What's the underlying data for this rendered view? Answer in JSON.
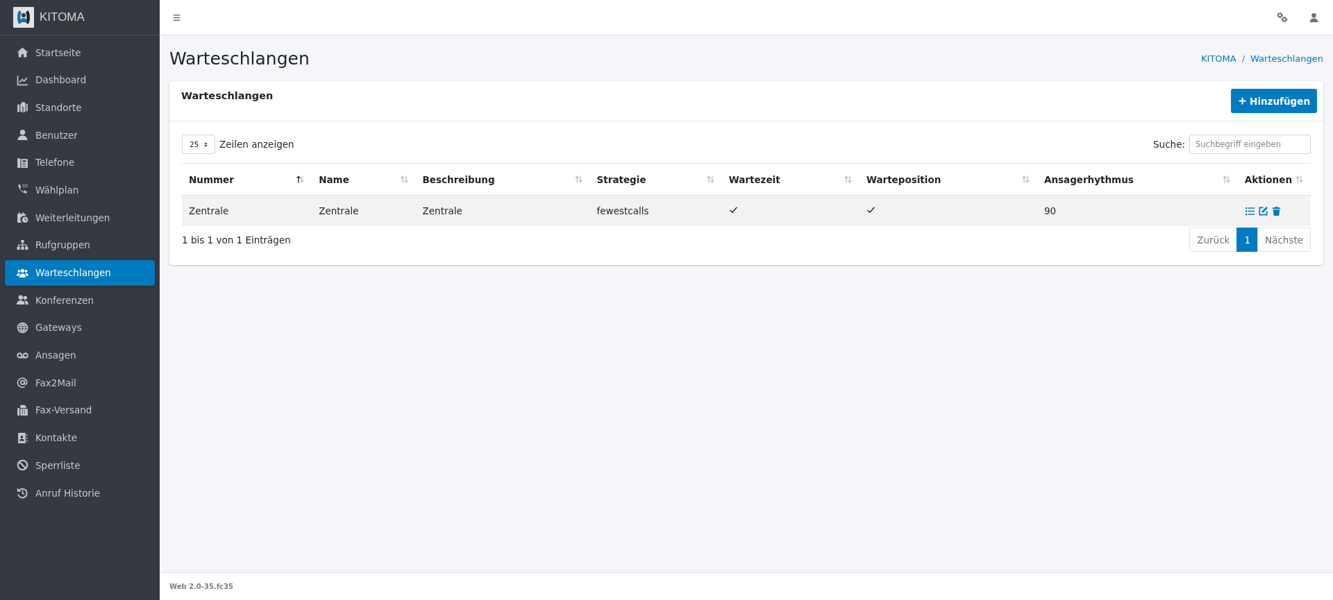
{
  "brand": {
    "name": "KITOMA"
  },
  "sidebar": {
    "items": [
      {
        "label": "Startseite",
        "selected": false
      },
      {
        "label": "Dashboard",
        "selected": false
      },
      {
        "label": "Standorte",
        "selected": false
      },
      {
        "label": "Benutzer",
        "selected": false
      },
      {
        "label": "Telefone",
        "selected": false
      },
      {
        "label": "Wählplan",
        "selected": false
      },
      {
        "label": "Weiterleitungen",
        "selected": false
      },
      {
        "label": "Rufgruppen",
        "selected": false
      },
      {
        "label": "Warteschlangen",
        "selected": true
      },
      {
        "label": "Konferenzen",
        "selected": false
      },
      {
        "label": "Gateways",
        "selected": false
      },
      {
        "label": "Ansagen",
        "selected": false
      },
      {
        "label": "Fax2Mail",
        "selected": false
      },
      {
        "label": "Fax-Versand",
        "selected": false
      },
      {
        "label": "Kontakte",
        "selected": false
      },
      {
        "label": "Sperrliste",
        "selected": false
      },
      {
        "label": "Anruf Historie",
        "selected": false
      }
    ]
  },
  "page": {
    "title": "Warteschlangen",
    "breadcrumb": [
      "KITOMA",
      "Warteschlangen"
    ],
    "breadcrumb_separator": "/"
  },
  "card": {
    "title": "Warteschlangen",
    "add_button": "Hinzufügen",
    "page_length": "25",
    "page_length_label": "Zeilen anzeigen",
    "search_label": "Suche:",
    "search": {
      "placeholder": "Suchbegriff eingeben"
    },
    "table": {
      "columns": [
        {
          "label": "Nummer",
          "sorted": true
        },
        {
          "label": "Name",
          "sorted": false
        },
        {
          "label": "Beschreibung",
          "sorted": false
        },
        {
          "label": "Strategie",
          "sorted": false
        },
        {
          "label": "Wartezeit",
          "sorted": false
        },
        {
          "label": "Warteposition",
          "sorted": false
        },
        {
          "label": "Ansagerhythmus",
          "sorted": false
        },
        {
          "label": "Aktionen",
          "sorted": false
        }
      ],
      "rows": [
        {
          "nummer": "Zentrale",
          "name": "Zentrale",
          "beschreibung": "Zentrale",
          "strategie": "fewestcalls",
          "wartezeit": true,
          "warteposition": true,
          "ansagerhythmus": "90"
        }
      ]
    },
    "info": "1 bis 1 von 1 Einträgen",
    "pagination": [
      {
        "label": "Zurück",
        "selected": false,
        "disabled": true
      },
      {
        "label": "1",
        "selected": true,
        "disabled": false
      },
      {
        "label": "Nächste",
        "selected": false,
        "disabled": true
      }
    ]
  },
  "footer": {
    "version": "Web 2.0-35.fc35"
  }
}
